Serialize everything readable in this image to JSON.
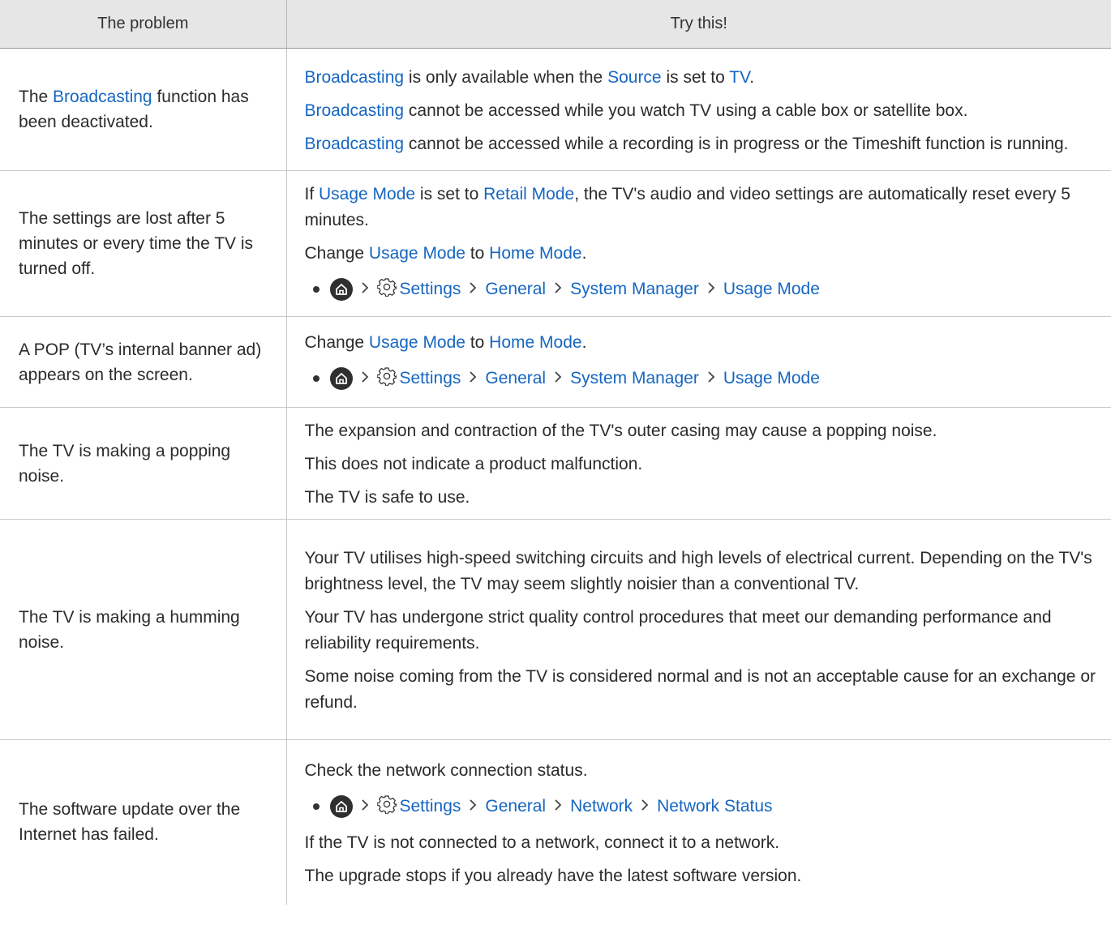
{
  "header": {
    "col_problem": "The problem",
    "col_try": "Try this!"
  },
  "rows": [
    {
      "problem": [
        "The ",
        "Broadcasting",
        " function has been deactivated."
      ],
      "solutions": [
        [
          "",
          "Broadcasting",
          " is only available when the ",
          "Source",
          " is set to ",
          "TV",
          "."
        ],
        [
          "",
          "Broadcasting",
          " cannot be accessed while you watch TV using a cable box or satellite box."
        ],
        [
          "",
          "Broadcasting",
          " cannot be accessed while a recording is in progress or the Timeshift function is running."
        ]
      ]
    },
    {
      "problem": "The settings are lost after 5 minutes or every time the TV is turned off.",
      "solutions": [
        [
          "If ",
          "Usage Mode",
          " is set to ",
          "Retail Mode",
          ", the TV's audio and video settings are automatically reset every 5 minutes."
        ],
        [
          "Change ",
          "Usage Mode",
          " to ",
          "Home Mode",
          "."
        ]
      ],
      "path": [
        "Settings",
        "General",
        "System Manager",
        "Usage Mode"
      ]
    },
    {
      "problem": "A POP (TV’s internal banner ad) appears on the screen.",
      "solutions": [
        [
          "Change ",
          "Usage Mode",
          " to ",
          "Home Mode",
          "."
        ]
      ],
      "path": [
        "Settings",
        "General",
        "System Manager",
        "Usage Mode"
      ]
    },
    {
      "problem": "The TV is making a popping noise.",
      "solutions": [
        "The expansion and contraction of the TV's outer casing may cause a popping noise.",
        "This does not indicate a product malfunction.",
        "The TV is safe to use."
      ]
    },
    {
      "problem": "The TV is making a humming noise.",
      "solutions": [
        "Your TV utilises high-speed switching circuits and high levels of electrical current. Depending on the TV's brightness level, the TV may seem slightly noisier than a conventional TV.",
        "Your TV has undergone strict quality control procedures that meet our demanding performance and reliability requirements.",
        "Some noise coming from the TV is considered normal and is not an acceptable cause for an exchange or refund."
      ]
    },
    {
      "problem": "The software update over the Internet has failed.",
      "solutions_before": [
        "Check the network connection status."
      ],
      "path": [
        "Settings",
        "General",
        "Network",
        "Network Status"
      ],
      "solutions_after": [
        "If the TV is not connected to a network, connect it to a network.",
        "The upgrade stops if you already have the latest software version."
      ]
    }
  ],
  "icons": {
    "home": "home-icon",
    "settings": "gear-icon",
    "separator": "chevron-right-icon"
  },
  "colors": {
    "link": "#1666c1",
    "header_bg": "#e6e6e6"
  }
}
